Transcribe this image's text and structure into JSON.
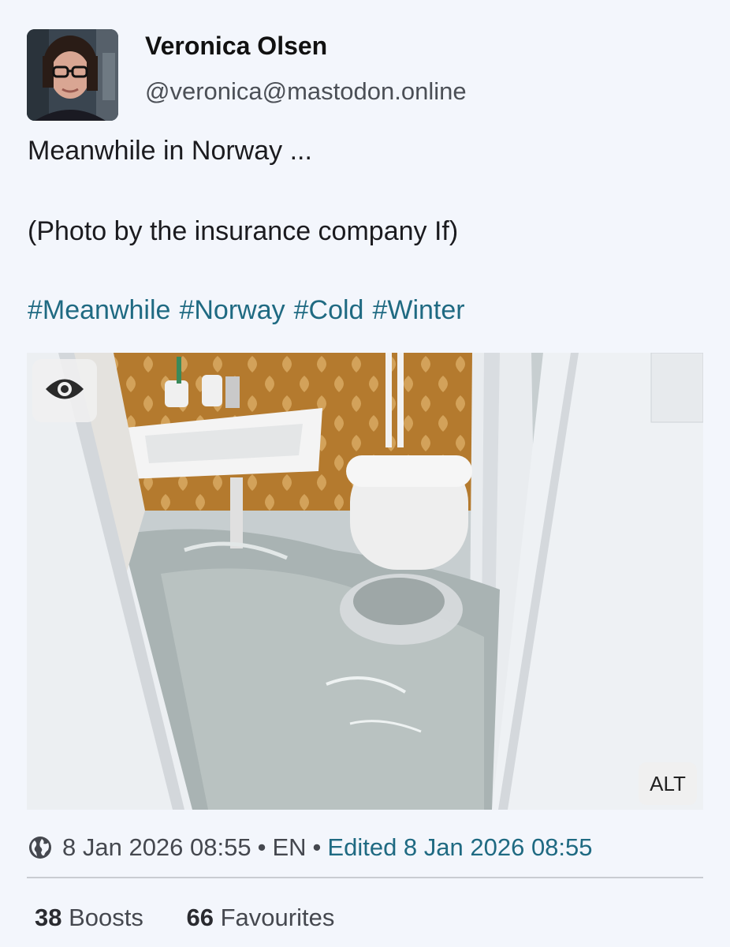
{
  "author": {
    "display_name": "Veronica Olsen",
    "handle": "@veronica@mastodon.online"
  },
  "content": {
    "line1": "Meanwhile in Norway ...",
    "line2": "(Photo by the insurance company If)",
    "hashtags": [
      "#Meanwhile",
      "#Norway",
      "#Cold",
      "#Winter"
    ]
  },
  "media": {
    "sensitive_toggle_icon": "eye-icon",
    "alt_label": "ALT"
  },
  "meta": {
    "visibility_icon": "globe-icon",
    "date": "8 Jan 2026 08:55",
    "separator": "•",
    "language": "EN",
    "edited": "Edited 8 Jan 2026 08:55"
  },
  "stats": {
    "boosts_count": "38",
    "boosts_label": "Boosts",
    "favourites_count": "66",
    "favourites_label": "Favourites"
  },
  "colors": {
    "background": "#f3f6fc",
    "link": "#1f6a82",
    "secondary_text": "#45484f"
  }
}
